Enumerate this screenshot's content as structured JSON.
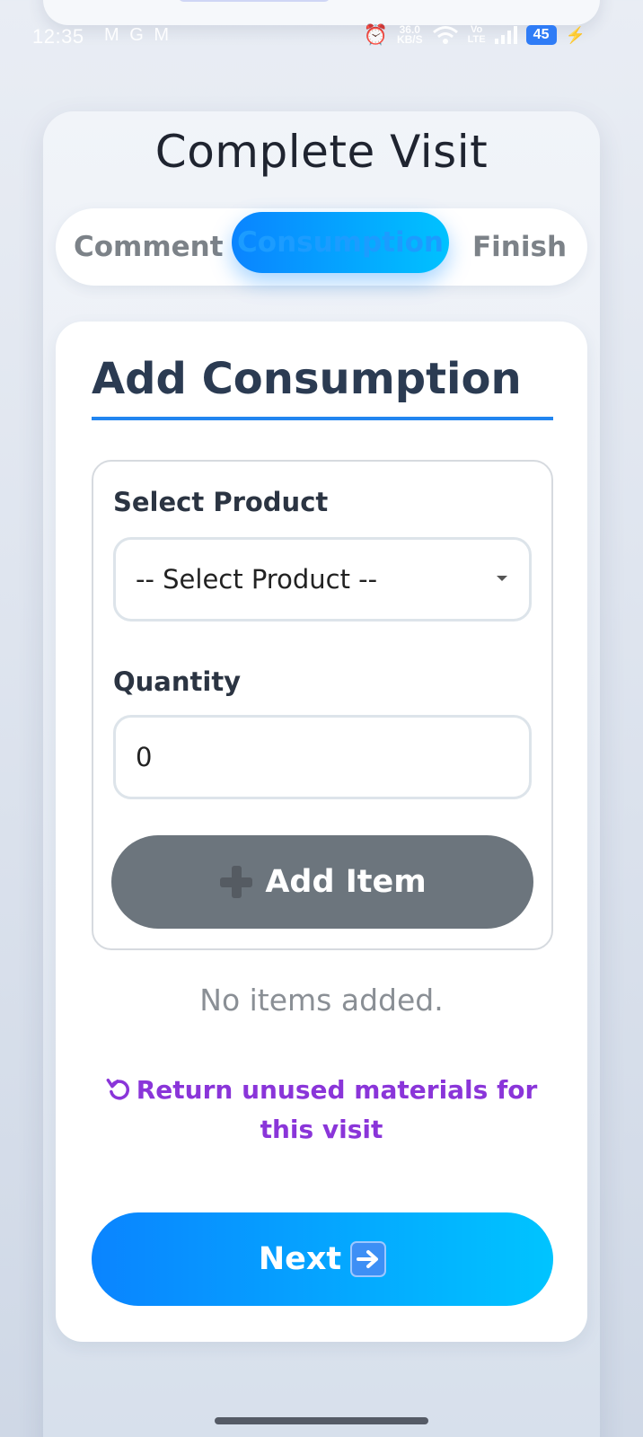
{
  "status_bar": {
    "time": "12:35",
    "app_icons": "M G M",
    "net_speed_value": "36.0",
    "net_speed_unit": "KB/S",
    "wifi_label": "4",
    "volte_top": "Vo",
    "volte_bottom": "LTE",
    "battery": "45"
  },
  "page": {
    "title": "Complete Visit"
  },
  "steps": {
    "items": [
      "Comment",
      "Consumption",
      "Finish"
    ],
    "active": "Consumption",
    "active_color": "#0a84ff"
  },
  "form": {
    "section_title": "Add Consumption",
    "product_label": "Select Product",
    "product_selected": "-- Select Product --",
    "quantity_label": "Quantity",
    "quantity_value": "0",
    "add_button_label": "Add Item",
    "add_button_icon": "plus-icon"
  },
  "items": {
    "empty_text": "No items added."
  },
  "return_link": {
    "label": "Return unused materials for this visit",
    "icon": "undo-icon",
    "color": "#8a35d9"
  },
  "next_button": {
    "label": "Next",
    "icon": "arrow-right-icon"
  }
}
